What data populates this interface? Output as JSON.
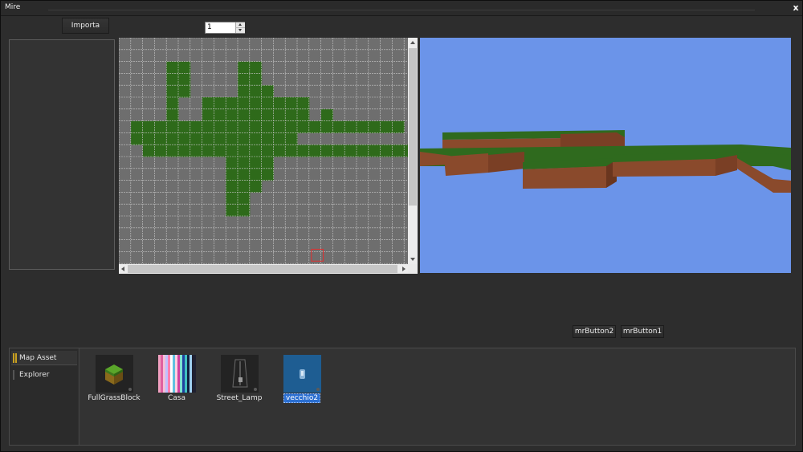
{
  "window": {
    "title": "Mire",
    "close_glyph": "x"
  },
  "toolbar": {
    "import_label": "Importa",
    "layer_value": "1"
  },
  "editor": {
    "grid_cols": 24,
    "grid_rows": 19,
    "filled_rows": [
      "....................",
      "....................",
      "....##....##........",
      "....##....##........",
      "....##....###.......",
      "....#..#########....",
      "....#..#########.#..",
      ".#######################",
      ".##############.........",
      "..#########################",
      ".........####..........",
      ".........####..........",
      ".........###...........",
      ".........##............",
      ".........##............",
      "......................."
    ]
  },
  "viewport": {
    "sky_color": "#6b94e9",
    "grass_color": "#2f6a1e",
    "dirt_color": "#8a4a2c"
  },
  "buttons": {
    "mr2": "mrButton2",
    "mr1": "mrButton1"
  },
  "tabs": {
    "map_asset": "Map Asset",
    "explorer": "Explorer"
  },
  "assets": [
    {
      "label": "FullGrassBlock",
      "icon": "grass-block-icon"
    },
    {
      "label": "Casa",
      "icon": "color-stripes-icon"
    },
    {
      "label": "Street_Lamp",
      "icon": "street-lamp-icon"
    },
    {
      "label": "vecchio2",
      "icon": "lantern-icon",
      "selected": true
    }
  ]
}
